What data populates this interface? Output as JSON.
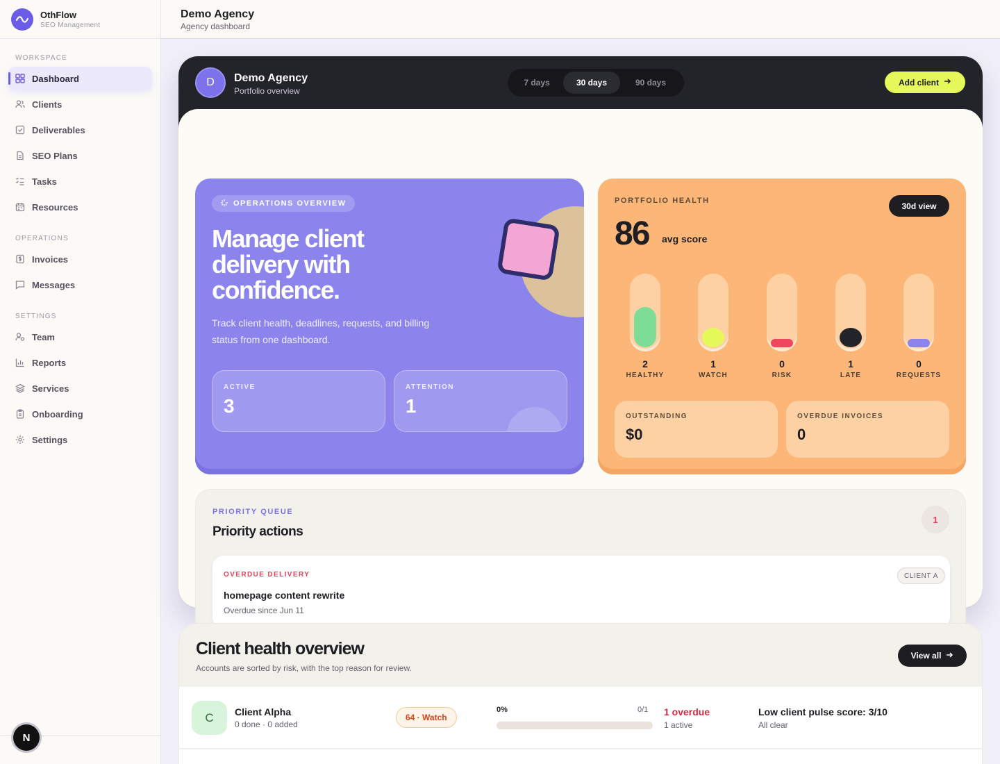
{
  "brand": {
    "name": "OthFlow",
    "subtitle": "SEO Management"
  },
  "sidebar": {
    "sections": [
      {
        "title": "WORKSPACE",
        "items": [
          {
            "label": "Dashboard",
            "icon": "grid-icon",
            "active": true
          },
          {
            "label": "Clients",
            "icon": "users-icon"
          },
          {
            "label": "Deliverables",
            "icon": "check-square-icon"
          },
          {
            "label": "SEO Plans",
            "icon": "document-icon"
          },
          {
            "label": "Tasks",
            "icon": "list-check-icon"
          },
          {
            "label": "Resources",
            "icon": "calendar-icon"
          }
        ]
      },
      {
        "title": "OPERATIONS",
        "items": [
          {
            "label": "Invoices",
            "icon": "dollar-file-icon"
          },
          {
            "label": "Messages",
            "icon": "message-icon"
          }
        ]
      },
      {
        "title": "SETTINGS",
        "items": [
          {
            "label": "Team",
            "icon": "team-icon"
          },
          {
            "label": "Reports",
            "icon": "bar-chart-icon"
          },
          {
            "label": "Services",
            "icon": "layers-icon"
          },
          {
            "label": "Onboarding",
            "icon": "clipboard-icon"
          },
          {
            "label": "Settings",
            "icon": "gear-icon"
          }
        ]
      }
    ],
    "next_badge": "N"
  },
  "topbar": {
    "title": "Demo Agency",
    "subtitle": "Agency dashboard"
  },
  "frame": {
    "avatar": "D",
    "title": "Demo Agency",
    "subtitle": "Portfolio overview",
    "ranges": [
      "7 days",
      "30 days",
      "90 days"
    ],
    "selected_range": "30 days",
    "add_client": "Add client"
  },
  "operations": {
    "pill": "OPERATIONS OVERVIEW",
    "headline": "Manage client delivery with confidence.",
    "description": "Track client health, deadlines, requests, and billing status from one dashboard.",
    "stats": [
      {
        "label": "ACTIVE",
        "value": "3"
      },
      {
        "label": "ATTENTION",
        "value": "1"
      }
    ]
  },
  "health": {
    "label": "PORTFOLIO HEALTH",
    "view_button": "30d view",
    "score": "86",
    "score_label": "avg score",
    "pills": [
      {
        "count": "2",
        "label": "HEALTHY",
        "color": "#7ddc96"
      },
      {
        "count": "1",
        "label": "WATCH",
        "color": "#e6f95a"
      },
      {
        "count": "0",
        "label": "RISK",
        "color": "#f0475f"
      },
      {
        "count": "1",
        "label": "LATE",
        "color": "#23232a"
      },
      {
        "count": "0",
        "label": "REQUESTS",
        "color": "#8a84ec"
      }
    ],
    "boxes": [
      {
        "label": "OUTSTANDING",
        "value": "$0"
      },
      {
        "label": "OVERDUE INVOICES",
        "value": "0"
      }
    ]
  },
  "priority": {
    "label": "PRIORITY QUEUE",
    "title": "Priority actions",
    "count": "1",
    "items": [
      {
        "tag": "OVERDUE DELIVERY",
        "title": "homepage content rewrite",
        "subtitle": "Overdue since Jun 11",
        "client": "CLIENT A"
      }
    ]
  },
  "client_health": {
    "title": "Client health overview",
    "subtitle": "Accounts are sorted by risk, with the top reason for review.",
    "view_all": "View all",
    "rows": [
      {
        "initial": "C",
        "name": "Client Alpha",
        "meta": "0 done · 0 added",
        "badge": "64 · Watch",
        "progress_label": "0%",
        "progress_count": "0/1",
        "progress": 0,
        "overdue": "1 overdue",
        "overdue_sub": "1 active",
        "reason": "Low client pulse score: 3/10",
        "reason_sub": "All clear"
      }
    ]
  },
  "colors": {
    "accent": "#7c72ea",
    "ops_card": "#8a84ec",
    "health_card": "#fcb677",
    "lime": "#e6f95a",
    "danger": "#d9283f"
  }
}
